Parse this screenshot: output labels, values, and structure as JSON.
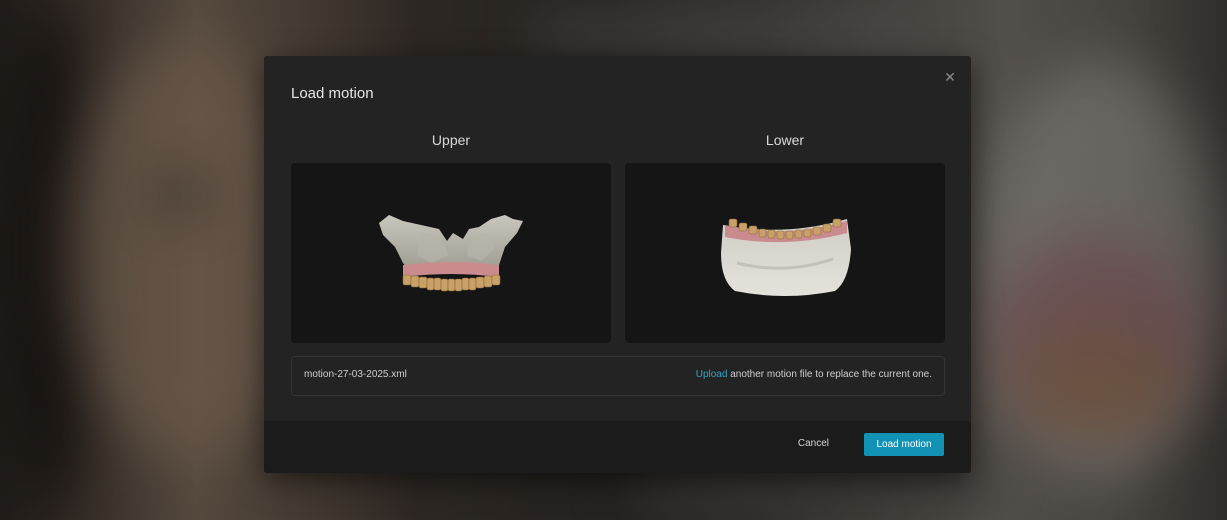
{
  "dialog": {
    "title": "Load motion",
    "close_icon": "close-icon",
    "columns": {
      "upper": {
        "label": "Upper",
        "image": "upper-jaw-3d-model"
      },
      "lower": {
        "label": "Lower",
        "image": "lower-jaw-3d-model"
      }
    },
    "file": {
      "name": "motion-27-03-2025.xml",
      "upload_link": "Upload",
      "hint_rest": " another motion file to replace the current one."
    },
    "footer": {
      "cancel_label": "Cancel",
      "load_label": "Load motion"
    }
  },
  "colors": {
    "accent": "#1292b5",
    "link": "#2aa6c6",
    "dialog_bg": "#232323",
    "panel_bg": "#151515"
  }
}
